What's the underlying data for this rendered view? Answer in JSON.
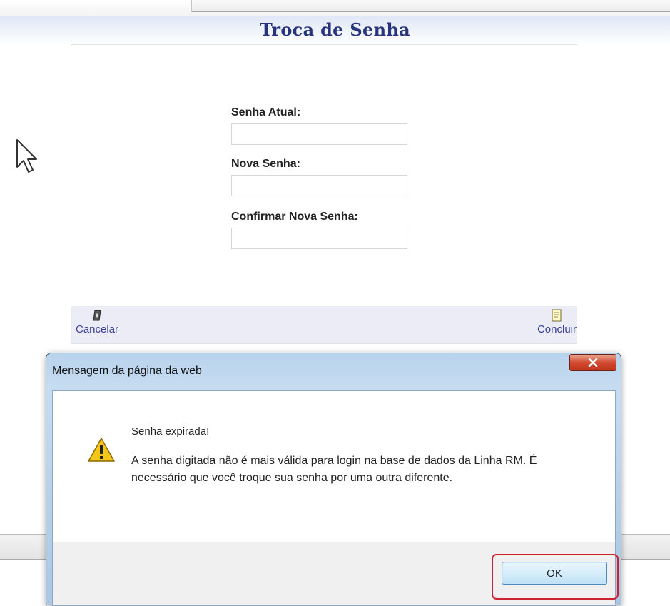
{
  "page": {
    "title": "Troca de Senha"
  },
  "form": {
    "current_password_label": "Senha Atual:",
    "current_password_value": "",
    "new_password_label": "Nova Senha:",
    "new_password_value": "",
    "confirm_password_label": "Confirmar Nova Senha:",
    "confirm_password_value": ""
  },
  "actions": {
    "cancel_label": "Cancelar",
    "cancel_icon": "cancel-icon",
    "finish_label": "Concluir",
    "finish_icon": "document-icon"
  },
  "dialog": {
    "title": "Mensagem da página da web",
    "icon": "warning-icon",
    "heading": "Senha expirada!",
    "message": "A senha digitada não é mais válida para login na base de dados da Linha RM. É necessário que você troque sua senha por uma outra diferente.",
    "ok_label": "OK",
    "highlight_color": "#cc2233"
  },
  "colors": {
    "title_color": "#27337a",
    "link_color": "#3a3f9a"
  }
}
